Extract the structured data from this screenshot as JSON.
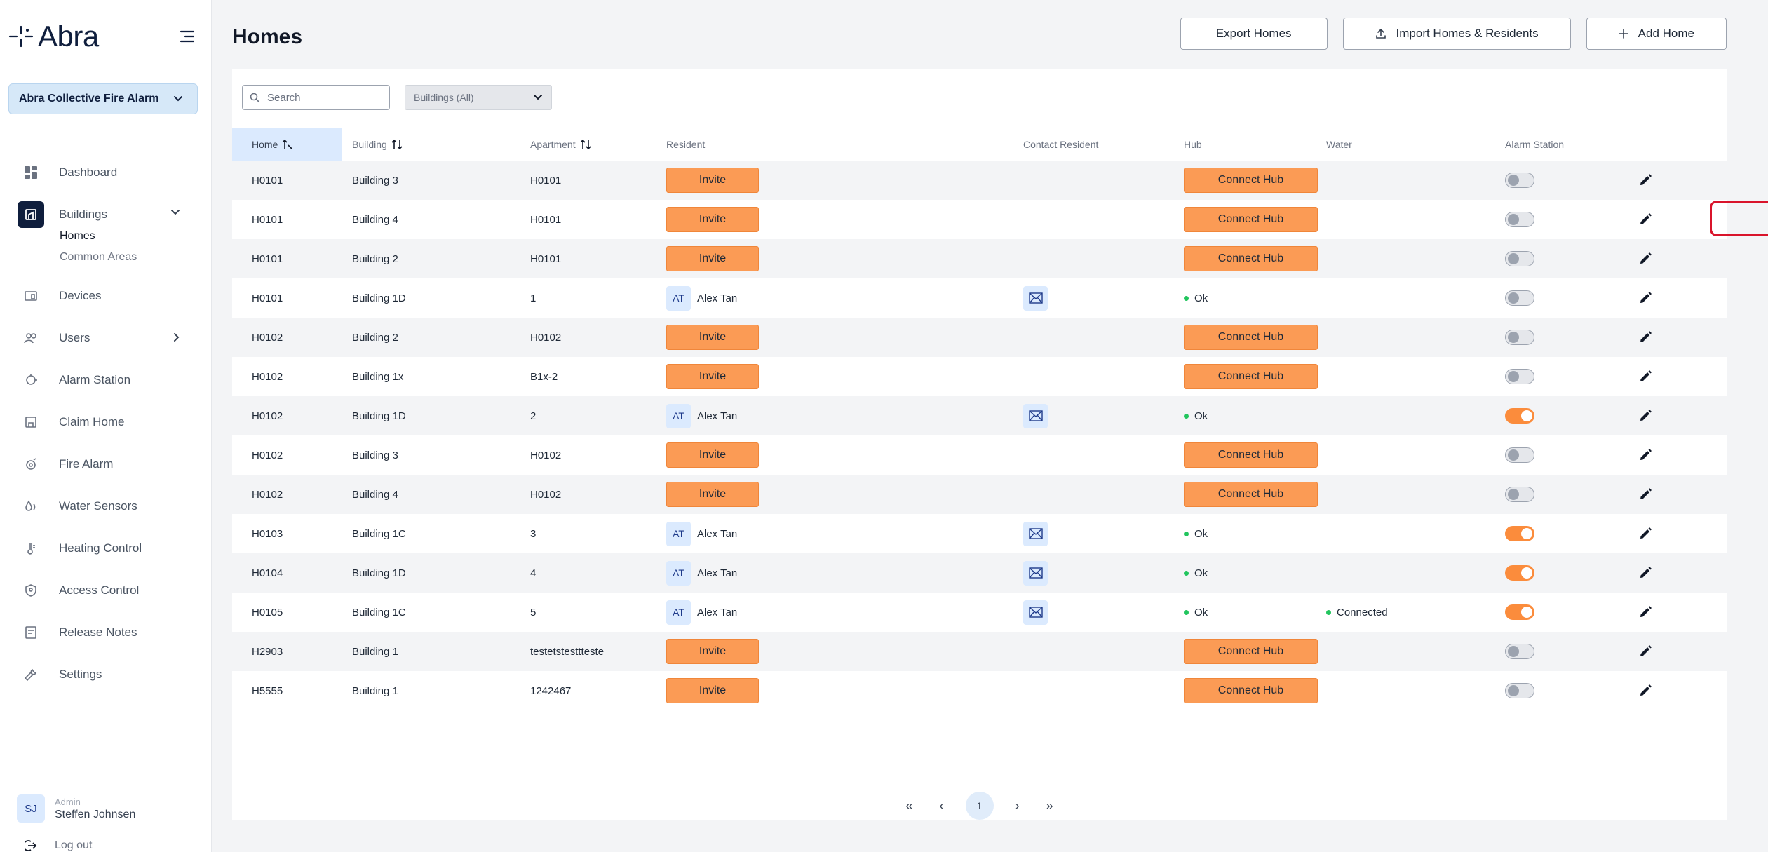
{
  "app": {
    "brand": "Abra",
    "organization": "Abra Collective Fire Alarm"
  },
  "nav": [
    {
      "label": "Dashboard"
    },
    {
      "label": "Buildings"
    },
    {
      "label": "Devices"
    },
    {
      "label": "Users"
    },
    {
      "label": "Alarm Station"
    },
    {
      "label": "Claim Home"
    },
    {
      "label": "Fire Alarm"
    },
    {
      "label": "Water Sensors"
    },
    {
      "label": "Heating Control"
    },
    {
      "label": "Access Control"
    },
    {
      "label": "Release Notes"
    },
    {
      "label": "Settings"
    }
  ],
  "subnav": [
    {
      "label": "Homes"
    },
    {
      "label": "Common Areas"
    }
  ],
  "user": {
    "initials": "SJ",
    "role": "Admin",
    "name": "Steffen Johnsen",
    "logout": "Log out"
  },
  "page": {
    "title": "Homes",
    "export_label": "Export Homes",
    "import_label": "Import Homes & Residents",
    "add_label": "Add Home"
  },
  "filters": {
    "search_placeholder": "Search",
    "building_filter": "Buildings (All)"
  },
  "columns": {
    "home": "Home",
    "building": "Building",
    "apartment": "Apartment",
    "resident": "Resident",
    "contact": "Contact Resident",
    "hub": "Hub",
    "water": "Water",
    "alarm": "Alarm Station"
  },
  "labels": {
    "invite": "Invite",
    "connect_hub": "Connect Hub"
  },
  "rows": [
    {
      "home": "H0101",
      "building": "Building 3",
      "apartment": "H0101",
      "resident": null,
      "hub": null,
      "water": null,
      "alarm": false
    },
    {
      "home": "H0101",
      "building": "Building 4",
      "apartment": "H0101",
      "resident": null,
      "hub": null,
      "water": null,
      "alarm": false
    },
    {
      "home": "H0101",
      "building": "Building 2",
      "apartment": "H0101",
      "resident": null,
      "hub": null,
      "water": null,
      "alarm": false
    },
    {
      "home": "H0101",
      "building": "Building 1D",
      "apartment": "1",
      "resident": {
        "initials": "AT",
        "name": "Alex Tan"
      },
      "hub": "Ok",
      "water": null,
      "alarm": false
    },
    {
      "home": "H0102",
      "building": "Building 2",
      "apartment": "H0102",
      "resident": null,
      "hub": null,
      "water": null,
      "alarm": false
    },
    {
      "home": "H0102",
      "building": "Building 1x",
      "apartment": "B1x-2",
      "resident": null,
      "hub": null,
      "water": null,
      "alarm": false
    },
    {
      "home": "H0102",
      "building": "Building 1D",
      "apartment": "2",
      "resident": {
        "initials": "AT",
        "name": "Alex Tan"
      },
      "hub": "Ok",
      "water": null,
      "alarm": true
    },
    {
      "home": "H0102",
      "building": "Building 3",
      "apartment": "H0102",
      "resident": null,
      "hub": null,
      "water": null,
      "alarm": false
    },
    {
      "home": "H0102",
      "building": "Building 4",
      "apartment": "H0102",
      "resident": null,
      "hub": null,
      "water": null,
      "alarm": false
    },
    {
      "home": "H0103",
      "building": "Building 1C",
      "apartment": "3",
      "resident": {
        "initials": "AT",
        "name": "Alex Tan"
      },
      "hub": "Ok",
      "water": null,
      "alarm": true
    },
    {
      "home": "H0104",
      "building": "Building 1D",
      "apartment": "4",
      "resident": {
        "initials": "AT",
        "name": "Alex Tan"
      },
      "hub": "Ok",
      "water": null,
      "alarm": true
    },
    {
      "home": "H0105",
      "building": "Building 1C",
      "apartment": "5",
      "resident": {
        "initials": "AT",
        "name": "Alex Tan"
      },
      "hub": "Ok",
      "water": "Connected",
      "alarm": true
    },
    {
      "home": "H2903",
      "building": "Building 1",
      "apartment": "testetstesttteste",
      "resident": null,
      "hub": null,
      "water": null,
      "alarm": false
    },
    {
      "home": "H5555",
      "building": "Building 1",
      "apartment": "1242467",
      "resident": null,
      "hub": null,
      "water": null,
      "alarm": false
    }
  ],
  "pagination": {
    "current": "1"
  },
  "colors": {
    "accent_orange": "#fb9b55",
    "navy": "#0f1e3d",
    "highlight_red": "#d9142b",
    "status_green": "#22c55e"
  }
}
